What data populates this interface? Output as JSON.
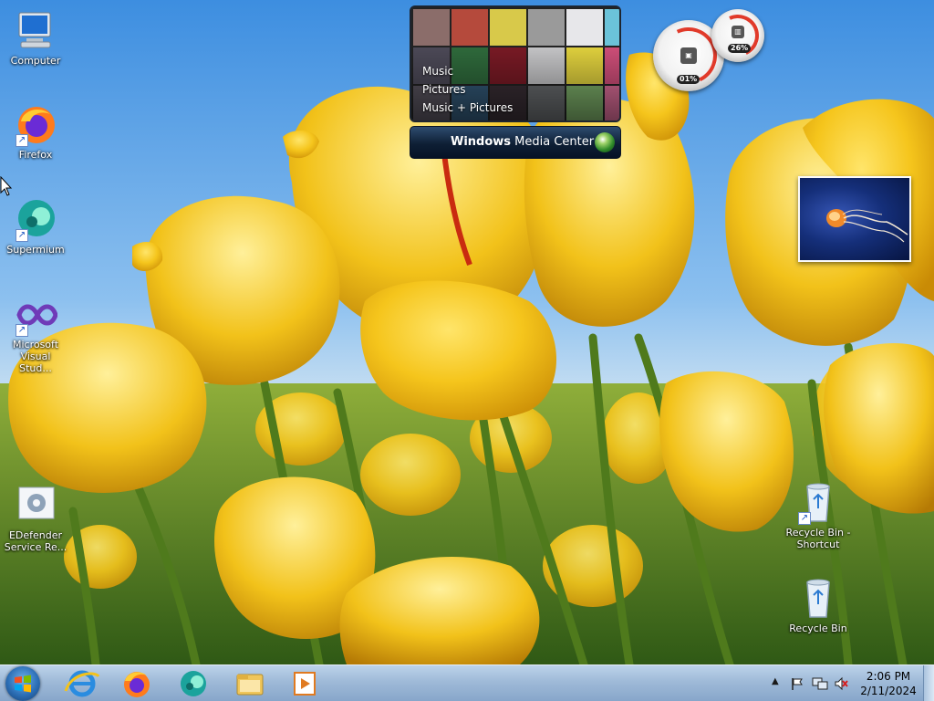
{
  "desktop": {
    "icons": [
      {
        "label": "Computer",
        "icon": "computer-icon"
      },
      {
        "label": "Firefox",
        "icon": "firefox-icon"
      },
      {
        "label": "Supermium",
        "icon": "supermium-icon"
      },
      {
        "label": "Microsoft Visual Stud...",
        "icon": "visual-studio-icon"
      },
      {
        "label": "EDefender Service Re...",
        "icon": "edefender-icon"
      },
      {
        "label": "Recycle Bin - Shortcut",
        "icon": "recycle-bin-shortcut-icon"
      },
      {
        "label": "Recycle Bin",
        "icon": "recycle-bin-icon"
      }
    ]
  },
  "media_center_gadget": {
    "menu": [
      "Music",
      "Pictures",
      "Music + Pictures"
    ],
    "title_bold": "Windows",
    "title_rest": " Media Center"
  },
  "cpu_gadget": {
    "cpu_label": "01%",
    "memory_label": "26%"
  },
  "photo_gadget": {
    "subject": "jellyfish"
  },
  "taskbar": {
    "pinned": [
      {
        "name": "internet-explorer",
        "icon": "internet-explorer-icon"
      },
      {
        "name": "firefox",
        "icon": "firefox-icon"
      },
      {
        "name": "supermium",
        "icon": "supermium-icon"
      },
      {
        "name": "file-explorer",
        "icon": "folder-icon"
      },
      {
        "name": "media-player",
        "icon": "media-player-icon"
      }
    ],
    "clock": {
      "time": "2:06 PM",
      "date": "2/11/2024"
    }
  },
  "colors": {
    "taskbar_top": "#bcd3ea",
    "taskbar_bottom": "#87a6ca",
    "tulip_yellow": "#f2c21a",
    "sky_blue": "#4f9be0"
  }
}
